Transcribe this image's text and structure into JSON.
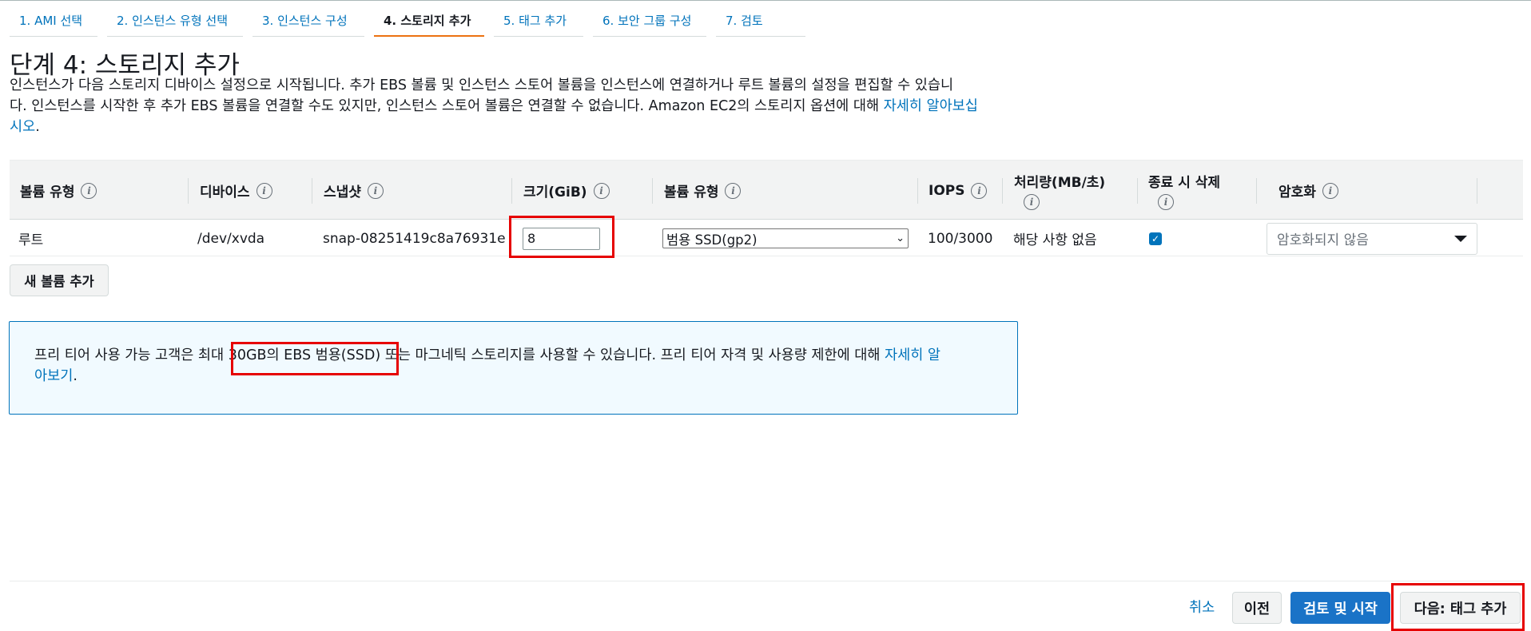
{
  "steps": [
    {
      "label": "1. AMI 선택"
    },
    {
      "label": "2. 인스턴스 유형 선택"
    },
    {
      "label": "3. 인스턴스 구성"
    },
    {
      "label": "4. 스토리지 추가"
    },
    {
      "label": "5. 태그 추가"
    },
    {
      "label": "6. 보안 그룹 구성"
    },
    {
      "label": "7. 검토"
    }
  ],
  "active_step_index": 3,
  "page_title": "단계 4: 스토리지 추가",
  "description": {
    "line1": "인스턴스가 다음 스토리지 디바이스 설정으로 시작됩니다. 추가 EBS 볼륨 및 인스턴스 스토어 볼륨을 인스턴스에 연결하거나 루트 볼륨의 설정을 편집할 수 있습니",
    "line2": "다. 인스턴스를 시작한 후 추가 EBS 볼륨을 연결할 수도 있지만, 인스턴스 스토어 볼륨은 연결할 수 없습니다. Amazon EC2의 스토리지 옵션에 대해 ",
    "link_part1": "자세히 알아보십",
    "link_part2": "시오",
    "end": "."
  },
  "table": {
    "headers": {
      "volume_type": "볼륨 유형",
      "device": "디바이스",
      "snapshot": "스냅샷",
      "size": "크기(GiB)",
      "ebs_volume_type": "볼륨 유형",
      "iops": "IOPS",
      "throughput": "처리량(MB/초)",
      "delete_on_termination": "종료 시 삭제",
      "encryption": "암호화"
    },
    "info_glyph": "i",
    "row": {
      "volume_type": "루트",
      "device": "/dev/xvda",
      "snapshot": "snap-08251419c8a76931e",
      "size": "8",
      "ebs_volume_type": "범용 SSD(gp2)",
      "iops": "100/3000",
      "throughput": "해당 사항 없음",
      "delete_on_termination": true,
      "encryption": "암호화되지 않음"
    }
  },
  "add_volume_button": "새 볼륨 추가",
  "free_tier": {
    "text_before": "프리 티어 사용 가능 고객은 최대 ",
    "highlight": "30GB의 EBS 범용(SSD)",
    "text_after": " 또는 마그네틱 스토리지를 사용할 수 있습니다. 프리 티어 자격 및 사용량 제한에 대해 ",
    "link_part1": "자세히 알",
    "link_part2": "아보기",
    "end": "."
  },
  "footer": {
    "cancel": "취소",
    "previous": "이전",
    "review_and_launch": "검토 및 시작",
    "next": "다음: 태그 추가"
  },
  "colors": {
    "link": "#0073bb",
    "active_tab": "#ec7211",
    "primary_button": "#1a73c7",
    "highlight_border": "#e60000",
    "info_box_bg": "#f1faff"
  }
}
